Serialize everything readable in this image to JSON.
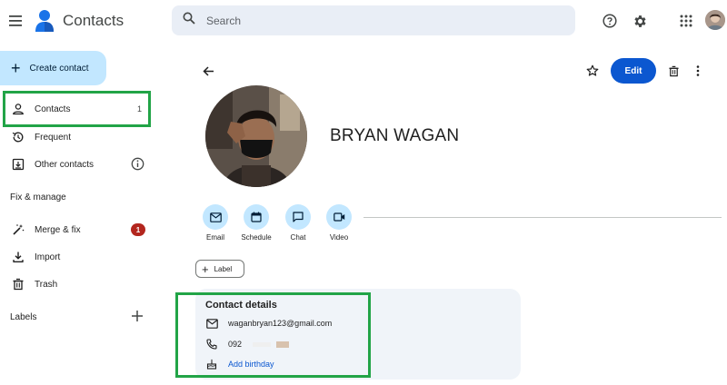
{
  "header": {
    "app_title": "Contacts",
    "search_placeholder": "Search",
    "icons": [
      "menu-icon",
      "help-icon",
      "settings-icon",
      "apps-grid-icon"
    ]
  },
  "sidebar": {
    "create_label": "Create contact",
    "nav": [
      {
        "label": "Contacts",
        "count": "1",
        "icon": "person-icon"
      },
      {
        "label": "Frequent",
        "icon": "history-icon"
      },
      {
        "label": "Other contacts",
        "icon": "archive-down-icon"
      }
    ],
    "fix_manage_heading": "Fix & manage",
    "manage_items": [
      {
        "label": "Merge & fix",
        "badge": "1",
        "icon": "magic-wand-icon"
      },
      {
        "label": "Import",
        "icon": "download-icon"
      },
      {
        "label": "Trash",
        "icon": "trash-icon"
      }
    ],
    "labels_heading": "Labels"
  },
  "contact": {
    "name": "BRYAN WAGAN",
    "edit_label": "Edit",
    "actions": [
      {
        "label": "Email",
        "icon": "mail-icon"
      },
      {
        "label": "Schedule",
        "icon": "calendar-icon"
      },
      {
        "label": "Chat",
        "icon": "chat-icon"
      },
      {
        "label": "Video",
        "icon": "video-icon"
      }
    ],
    "label_chip": "Label",
    "details_title": "Contact details",
    "email": "waganbryan123@gmail.com",
    "phone": "092",
    "add_birthday": "Add birthday"
  },
  "colors": {
    "accent": "#0b57d0",
    "action_bg": "#c2e7ff",
    "highlight_box": "#22a447",
    "badge": "#b3261e"
  }
}
